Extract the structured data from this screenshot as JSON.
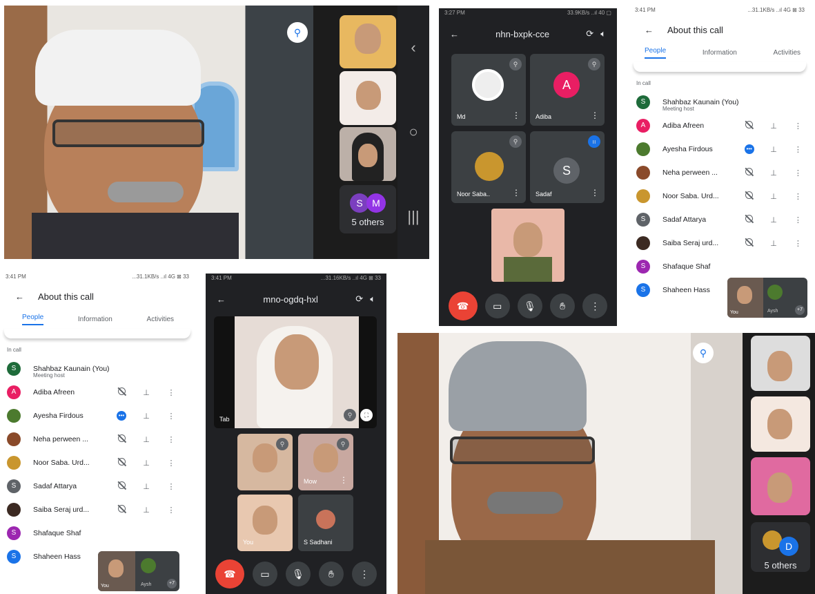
{
  "panel1": {
    "others_label": "5 others",
    "avatars": [
      "S",
      "M"
    ],
    "avatar_colors": [
      "#7b3fbf",
      "#9334e6"
    ]
  },
  "panel2": {
    "status_time": "3:27 PM",
    "status_right": "33.9KB/s ..ıl 40 ▢",
    "meeting_code": "nhn-bxpk-cce",
    "tiles": [
      {
        "name": "Md",
        "avatar": ""
      },
      {
        "name": "Adiba",
        "avatar": "A",
        "color": "#e91e63"
      },
      {
        "name": "Noor Saba..",
        "avatar": ""
      },
      {
        "name": "Sadaf",
        "avatar": "S",
        "color": "#5f6368"
      }
    ]
  },
  "panel3": {
    "status_time": "3:41 PM",
    "status_right": "...31.1KB/s ..ıl 4G ⊠ 33",
    "title": "About this call",
    "tabs": [
      "People",
      "Information",
      "Activities"
    ],
    "section": "In call",
    "people": [
      {
        "name": "Shahbaz Kaunain (You)",
        "sub": "Meeting host",
        "color": "#1e6b3a",
        "initial": "S"
      },
      {
        "name": "Adiba Afreen",
        "color": "#e91e63",
        "initial": "A"
      },
      {
        "name": "Ayesha Firdous",
        "color": "#4c7a2e",
        "initial": ""
      },
      {
        "name": "Neha perween ...",
        "color": "#8a4a2a",
        "initial": ""
      },
      {
        "name": "Noor Saba. Urd...",
        "color": "#c9962e",
        "initial": ""
      },
      {
        "name": "Sadaf Attarya",
        "color": "#5f6368",
        "initial": "S"
      },
      {
        "name": "Saiba Seraj urd...",
        "color": "#3c2a22",
        "initial": ""
      },
      {
        "name": "Shafaque Shaf",
        "color": "#9c27b0",
        "initial": "S"
      },
      {
        "name": "Shaheen Hass",
        "color": "#1a73e8",
        "initial": "S"
      }
    ],
    "pip_you": "You",
    "pip_other": "Aysh",
    "pip_count": "+7"
  },
  "panel4": {
    "status_time": "3:41 PM",
    "status_right": "...31.1KB/s ..ıl 4G ⊠ 33",
    "title": "About this call",
    "tabs": [
      "People",
      "Information",
      "Activities"
    ],
    "section": "In call",
    "people": [
      {
        "name": "Shahbaz Kaunain (You)",
        "sub": "Meeting host",
        "color": "#1e6b3a",
        "initial": "S"
      },
      {
        "name": "Adiba Afreen",
        "color": "#e91e63",
        "initial": "A"
      },
      {
        "name": "Ayesha Firdous",
        "color": "#4c7a2e",
        "initial": ""
      },
      {
        "name": "Neha perween ...",
        "color": "#8a4a2a",
        "initial": ""
      },
      {
        "name": "Noor Saba. Urd...",
        "color": "#c9962e",
        "initial": ""
      },
      {
        "name": "Sadaf Attarya",
        "color": "#5f6368",
        "initial": "S"
      },
      {
        "name": "Saiba Seraj urd...",
        "color": "#3c2a22",
        "initial": ""
      },
      {
        "name": "Shafaque Shaf",
        "color": "#9c27b0",
        "initial": "S"
      },
      {
        "name": "Shaheen Hass",
        "color": "#1a73e8",
        "initial": "S"
      }
    ],
    "pip_you": "You",
    "pip_other": "Aysh",
    "pip_count": "+7"
  },
  "panel5": {
    "status_time": "3:41 PM",
    "status_right": "...31.16KB/s ..ıl 4G ⊠ 33",
    "meeting_code": "mno-ogdq-hxl",
    "main_name": "Tab",
    "you_label": "You",
    "other_tile": "Mow",
    "sadaf_label": "Sadhani",
    "sadaf_initial": "S"
  },
  "panel6": {
    "others_label": "5 others",
    "avatar_letter": "D",
    "avatar_color": "#1a73e8"
  }
}
